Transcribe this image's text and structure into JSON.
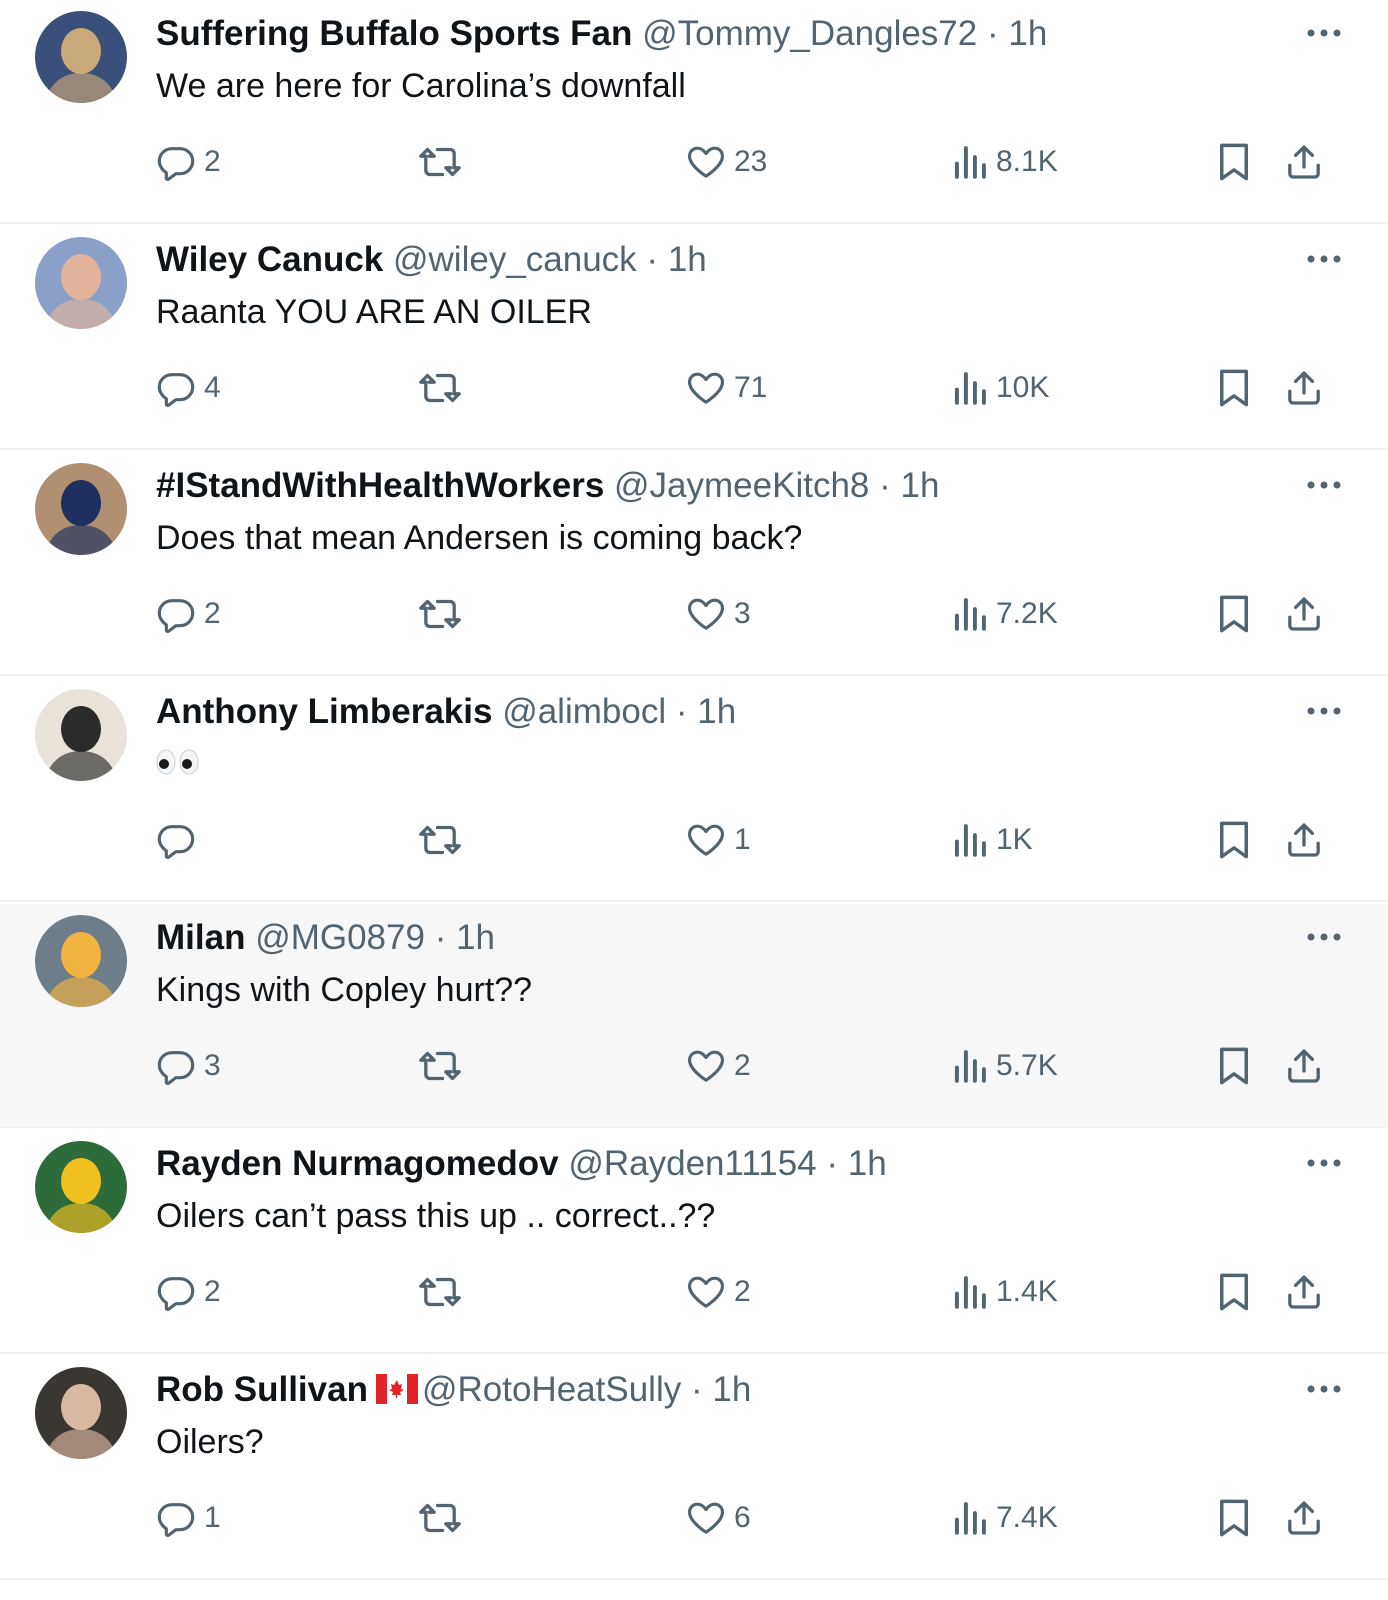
{
  "tweets": [
    {
      "name": "Suffering Buffalo Sports Fan",
      "handle": "@Tommy_Dangles72",
      "sep": "·",
      "time": "1h",
      "text": "We are here for Carolina’s downfall",
      "replies": "2",
      "likes": "23",
      "views": "8.1K",
      "avatar_colors": [
        "#3a4f7a",
        "#c9a87a"
      ]
    },
    {
      "name": "Wiley Canuck",
      "handle": "@wiley_canuck",
      "sep": "·",
      "time": "1h",
      "text": "Raanta YOU ARE AN OILER",
      "replies": "4",
      "likes": "71",
      "views": "10K",
      "avatar_colors": [
        "#8aa0c8",
        "#e0b39a"
      ]
    },
    {
      "name": "#IStandWithHealthWorkers",
      "handle": "@JaymeeKitch8",
      "sep": "·",
      "time": "1h",
      "text": "Does that mean Andersen is coming back?",
      "replies": "2",
      "likes": "3",
      "views": "7.2K",
      "avatar_colors": [
        "#b09070",
        "#1f2f60"
      ]
    },
    {
      "name": "Anthony Limberakis",
      "handle": "@alimbocl",
      "sep": "·",
      "time": "1h",
      "text": "",
      "emoji": "eyes",
      "replies": "",
      "likes": "1",
      "views": "1K",
      "avatar_colors": [
        "#e8e2d8",
        "#2b2b2b"
      ]
    },
    {
      "name": "Milan",
      "handle": "@MG0879",
      "sep": "·",
      "time": "1h",
      "text": "Kings with Copley hurt??",
      "replies": "3",
      "likes": "2",
      "views": "5.7K",
      "avatar_colors": [
        "#6e7d8a",
        "#f2b441"
      ],
      "highlighted": true
    },
    {
      "name": "Rayden Nurmagomedov",
      "handle": "@Rayden11154",
      "sep": "·",
      "time": "1h",
      "text": "Oilers can’t pass this up .. correct..??",
      "replies": "2",
      "likes": "2",
      "views": "1.4K",
      "avatar_colors": [
        "#2e6b3a",
        "#f0c020"
      ]
    },
    {
      "name": "Rob Sullivan",
      "handle": "@RotoHeatSully",
      "sep": "·",
      "time": "1h",
      "text": "Oilers?",
      "replies": "1",
      "likes": "6",
      "views": "7.4K",
      "avatar_colors": [
        "#3a3632",
        "#d8b8a0"
      ],
      "flag": "canada-flag-icon"
    }
  ],
  "colors": {
    "text": "#0f1419",
    "secondary": "#536471",
    "divider": "#eff3f4",
    "highlight_bg": "#f7f7f7",
    "flag_red": "#e0242a"
  }
}
